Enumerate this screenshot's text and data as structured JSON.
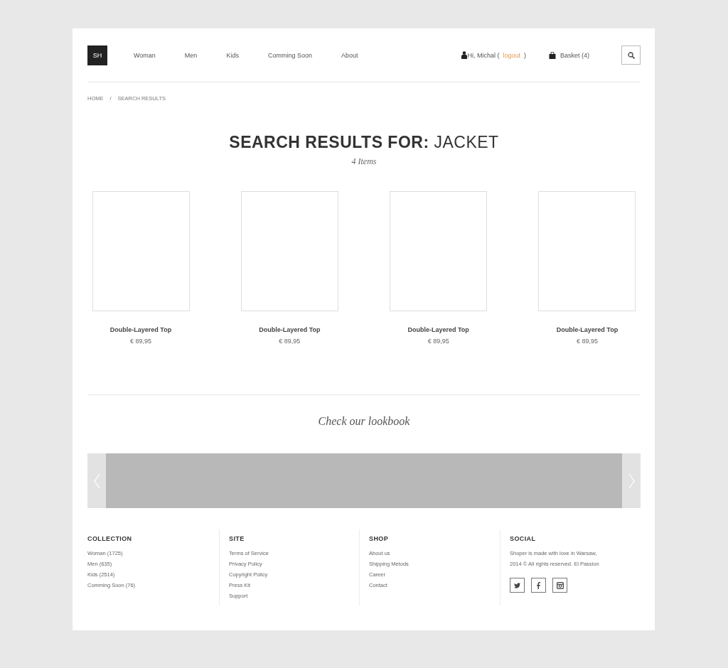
{
  "header": {
    "logo": "SH",
    "nav": [
      {
        "label": "Woman"
      },
      {
        "label": "Men"
      },
      {
        "label": "Kids"
      },
      {
        "label": "Comming Soon"
      },
      {
        "label": "About"
      }
    ],
    "greeting": "Hi, Michal (",
    "logout": "logout",
    "greeting_end": ")",
    "basket": "Basket (4)"
  },
  "breadcrumb": [
    "HOME",
    "/",
    "SEARCH RESULTS"
  ],
  "title": "**SEARCH RESULTS FOR:** JACKET",
  "subtitle": "4 Items",
  "products": [
    {
      "name": "Double-Layered Top",
      "price": "€ 89,95"
    },
    {
      "name": "Double-Layered Top",
      "price": "€ 89,95"
    },
    {
      "name": "Double-Layered Top",
      "price": "€ 89,95"
    },
    {
      "name": "Double-Layered Top",
      "price": "€ 89,95"
    }
  ],
  "lookbook": {
    "title": "Check our lookbook"
  },
  "footer": [
    {
      "heading": "COLLECTION",
      "kind": "links",
      "items": [
        "Woman (1725)",
        "Men (635)",
        "Kids (2514)",
        "Comming Soon (76)"
      ]
    },
    {
      "heading": "SITE",
      "kind": "links",
      "items": [
        "Terms of Service",
        "Privacy Policy",
        "Copyright Policy",
        "Press Kit",
        "Support"
      ]
    },
    {
      "heading": "SHOP",
      "kind": "links",
      "items": [
        "About us",
        "Shipping Metods",
        "Career",
        "Contact"
      ]
    },
    {
      "heading": "SOCIAL",
      "kind": "social",
      "items": [
        "Shoper is made with love in Warsaw,",
        "2014 © All rights reserved. El Passion"
      ]
    }
  ]
}
